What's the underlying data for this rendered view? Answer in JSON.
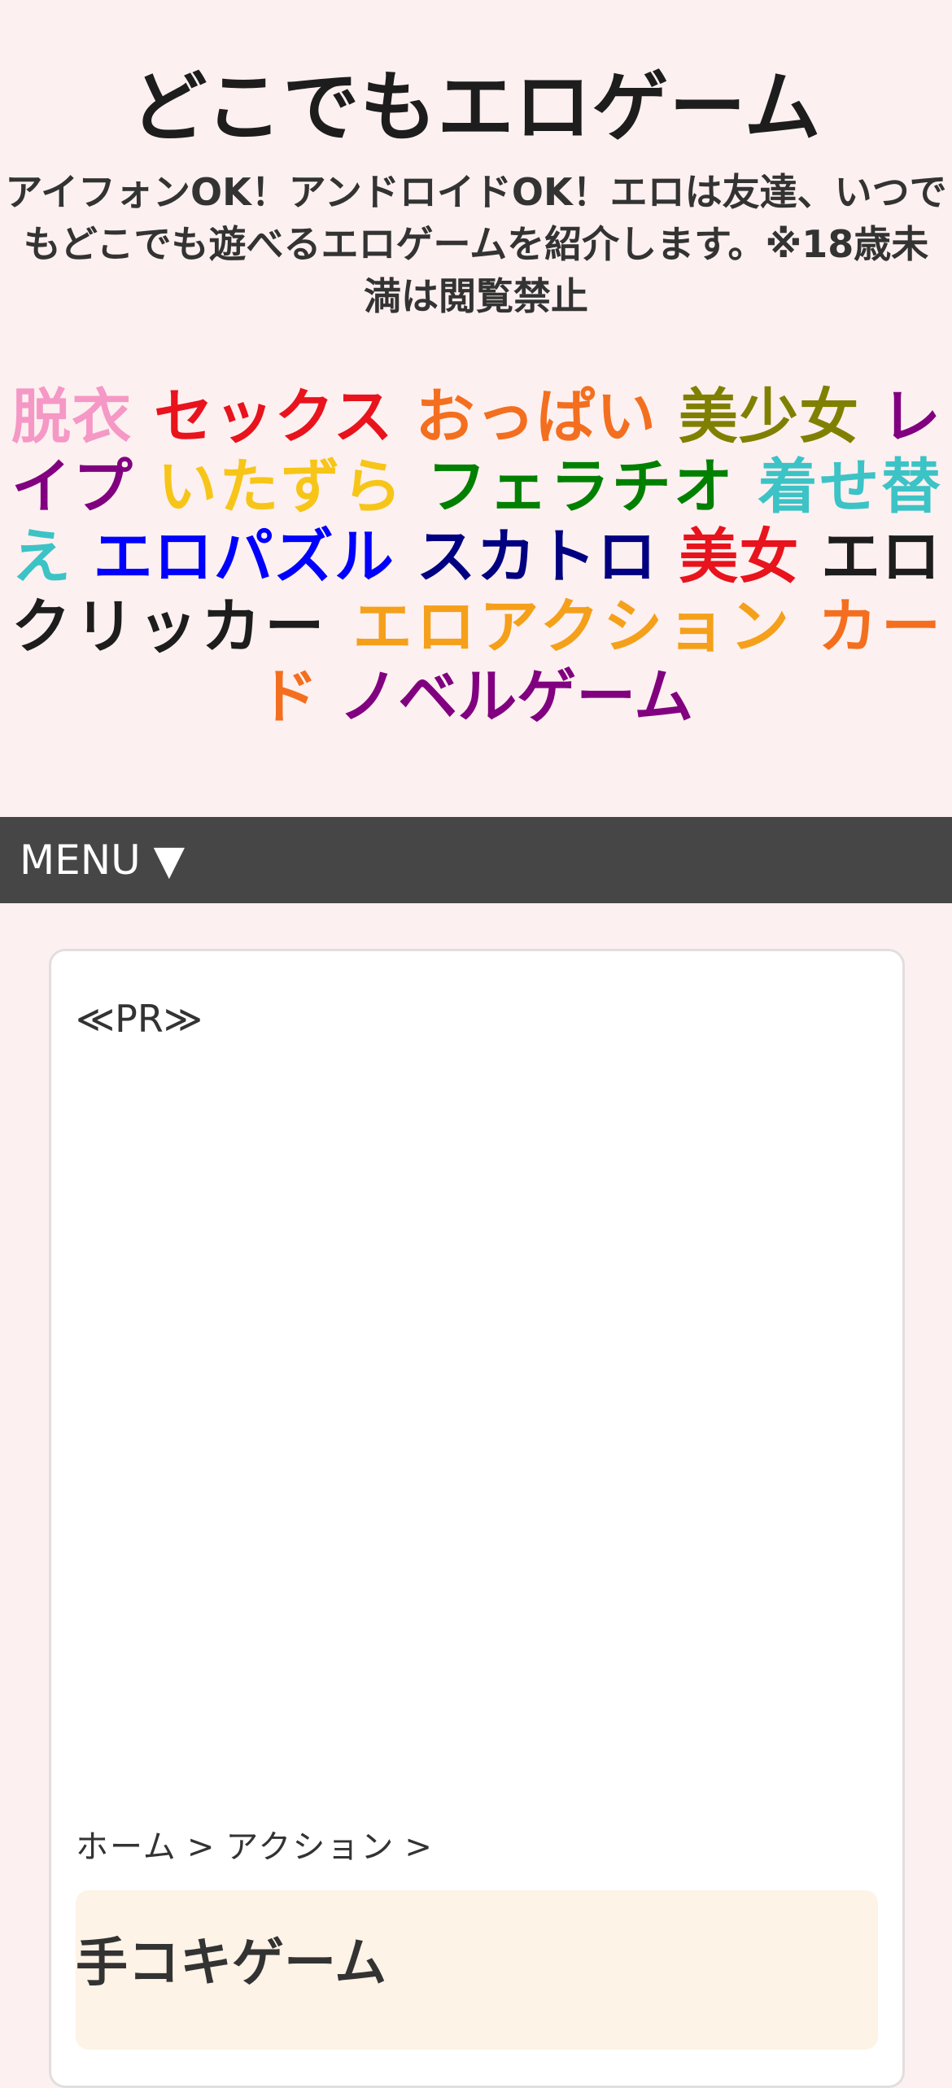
{
  "site": {
    "title": "どこでもエロゲーム",
    "description": "アイフォンOK！アンドロイドOK！エロは友達、いつでもどこでも遊べるエロゲームを紹介します。※18歳未満は閲覧禁止"
  },
  "tags": [
    {
      "label": "脱衣",
      "color": "#f598c6"
    },
    {
      "label": "セックス",
      "color": "#e8131c"
    },
    {
      "label": "おっぱい",
      "color": "#f36f1f"
    },
    {
      "label": "美少女",
      "color": "#808000"
    },
    {
      "label": "レイプ",
      "color": "#800080"
    },
    {
      "label": "いたずら",
      "color": "#f6c518"
    },
    {
      "label": "フェラチオ",
      "color": "#008000"
    },
    {
      "label": "着せ替え",
      "color": "#3cc3c6"
    },
    {
      "label": "エロパズル",
      "color": "#0000ff"
    },
    {
      "label": "スカトロ",
      "color": "#000080"
    },
    {
      "label": "美女",
      "color": "#e8131c"
    },
    {
      "label": "エロクリッカー",
      "color": "#1d1d1d"
    },
    {
      "label": "エロアクション",
      "color": "#f5a01a"
    },
    {
      "label": "カード",
      "color": "#f36f1f"
    },
    {
      "label": "ノベルゲーム",
      "color": "#800080"
    }
  ],
  "menu": {
    "label": "MENU ▼"
  },
  "card": {
    "pr_label": "≪PR≫",
    "breadcrumb": [
      "ホーム",
      "アクション"
    ],
    "breadcrumb_separator": ">",
    "article_title": "手コキゲーム"
  },
  "colors": {
    "page_background": "#fdf0f0",
    "menu_background": "#464646",
    "article_head_background": "#fdf3e6"
  }
}
